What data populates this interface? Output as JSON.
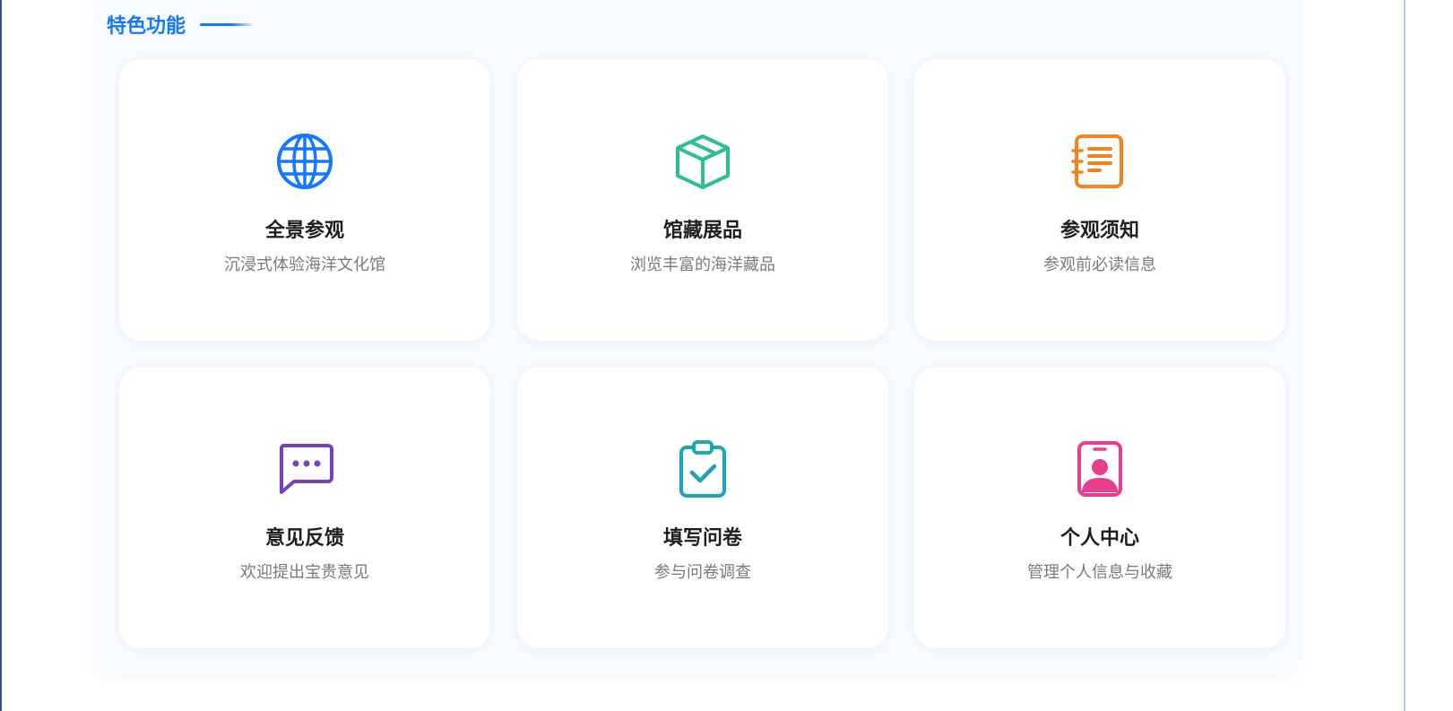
{
  "section": {
    "title": "特色功能"
  },
  "features": [
    {
      "title": "全景参观",
      "subtitle": "沉浸式体验海洋文化馆",
      "icon": "globe-icon",
      "color": "#1677ff"
    },
    {
      "title": "馆藏展品",
      "subtitle": "浏览丰富的海洋藏品",
      "icon": "cube-icon",
      "color": "#2ebf91"
    },
    {
      "title": "参观须知",
      "subtitle": "参观前必读信息",
      "icon": "notebook-icon",
      "color": "#f58220"
    },
    {
      "title": "意见反馈",
      "subtitle": "欢迎提出宝贵意见",
      "icon": "message-icon",
      "color": "#7a3fc0"
    },
    {
      "title": "填写问卷",
      "subtitle": "参与问卷调查",
      "icon": "clipboard-check-icon",
      "color": "#1aa6b7"
    },
    {
      "title": "个人中心",
      "subtitle": "管理个人信息与收藏",
      "icon": "user-badge-icon",
      "color": "#e83e8c"
    }
  ]
}
